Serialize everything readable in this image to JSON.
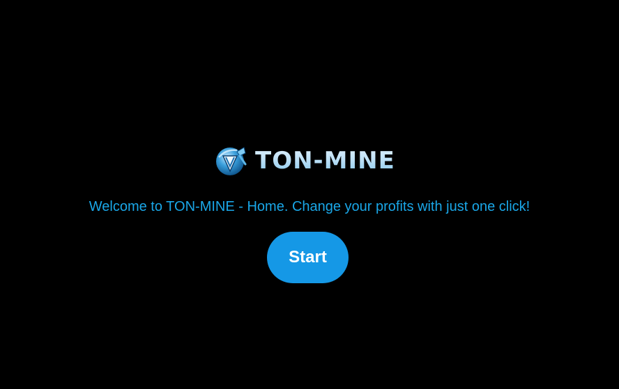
{
  "brand": {
    "logo_icon": "ton-mine-logo-icon",
    "name": "TON-MINE"
  },
  "tagline": "Welcome to TON-MINE - Home. Change your profits with just one click!",
  "start_button": {
    "label": "Start"
  },
  "colors": {
    "background": "#000000",
    "accent": "#1598e6",
    "tagline": "#1aa7e8",
    "button_text": "#ffffff"
  }
}
